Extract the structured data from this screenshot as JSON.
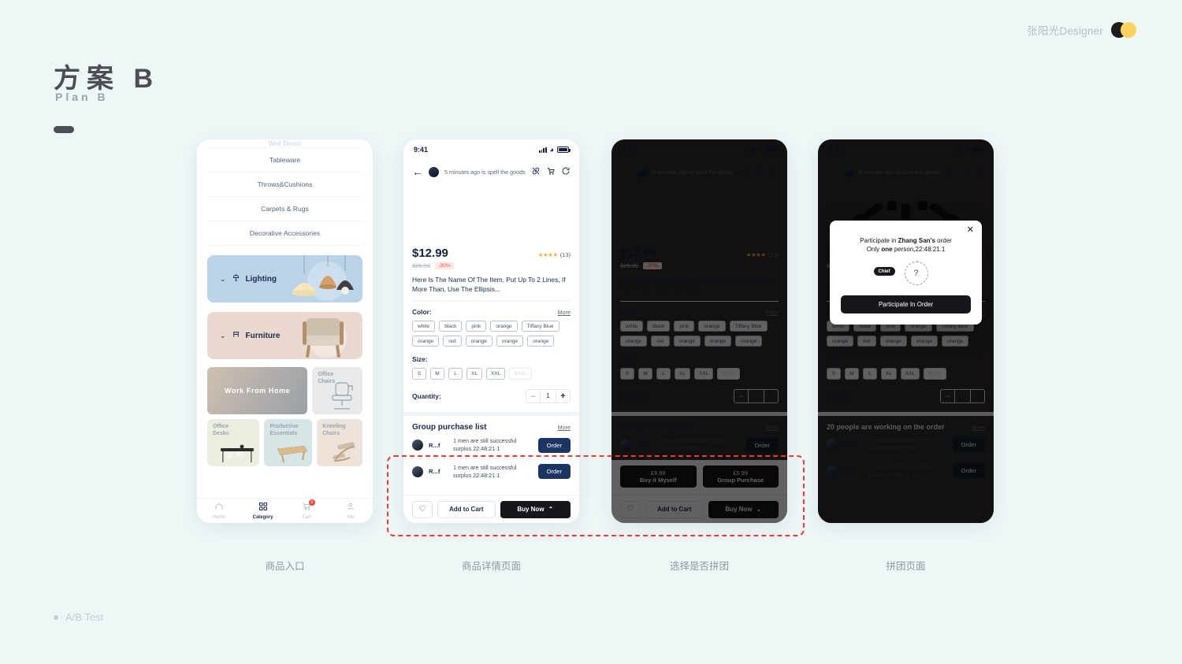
{
  "header": {
    "designer": "张阳光Designer",
    "title_cn": "方案 B",
    "title_en": "Plan B",
    "ab_test": "A/B Test"
  },
  "colors": {
    "background": "#eef6f6",
    "accent_navy": "#1c3461",
    "accent_dark": "#15171a",
    "annotation_red": "#ef3b35",
    "logo_yellow": "#fbd161",
    "lighting_banner": "#b9d3e8",
    "furniture_banner": "#ead9cf"
  },
  "statusbar": {
    "time": "9:41"
  },
  "phone1": {
    "categories": [
      "Wall Decor",
      "Tableware",
      "Throws&Cushions",
      "Carpets & Rugs",
      "Decorative Accessories"
    ],
    "banners": [
      {
        "label": "Lighting",
        "icon": "lamp-icon",
        "chevron": "⌄"
      },
      {
        "label": "Furniture",
        "icon": "stool-icon",
        "chevron": "⌄"
      }
    ],
    "tiles": [
      {
        "label": "Work From Home"
      },
      {
        "label": "Office\nChairs"
      },
      {
        "label": "Office\nDesks"
      },
      {
        "label": "Productive\nEssentials"
      },
      {
        "label": "Kneeling\nChairs"
      }
    ],
    "tabs": [
      {
        "label": "Home",
        "icon": "home-icon",
        "active": false,
        "badge": ""
      },
      {
        "label": "Category",
        "icon": "grid-icon",
        "active": true,
        "badge": ""
      },
      {
        "label": "Cart",
        "icon": "cart-icon",
        "active": false,
        "badge": "3"
      },
      {
        "label": "Me",
        "icon": "person-icon",
        "active": false,
        "badge": ""
      }
    ]
  },
  "detail": {
    "nav_text": "5 minutes ago is spell the goods",
    "nav_icons": [
      "link-off-icon",
      "cart-icon",
      "share-icon"
    ],
    "price": "$12.99",
    "old_price": "$25.99",
    "discount": "-30%",
    "stars": "★★★★",
    "rating_count": "(13)",
    "item_name": "Here Is The Name Of The Item, Put Up To 2 Lines, If More Than, Use The Ellipsis...",
    "color_label": "Color:",
    "more_label": "More",
    "colors": [
      "white",
      "black",
      "pink",
      "orange",
      "Tiffany Blue",
      "orange",
      "red",
      "orange",
      "orange",
      "orange"
    ],
    "size_label": "Size:",
    "sizes": [
      {
        "label": "S",
        "disabled": false
      },
      {
        "label": "M",
        "disabled": false
      },
      {
        "label": "L",
        "disabled": false
      },
      {
        "label": "XL",
        "disabled": false
      },
      {
        "label": "XXL",
        "disabled": false
      },
      {
        "label": "XXXL",
        "disabled": true
      }
    ],
    "quantity_label": "Quantity:",
    "quantity_value": "1",
    "quantity_minus": "–",
    "quantity_plus": "+",
    "group_title": "Group purchase list",
    "group_more": "More",
    "group_rows": [
      {
        "nick": "R...f",
        "desc": "1 men are still successful surplus 22:48:21·1",
        "action": "Order"
      },
      {
        "nick": "R...f",
        "desc": "1 men are still successful surplus 22:48:21·1",
        "action": "Order"
      }
    ],
    "bottom": {
      "favorite_icon": "heart-icon",
      "add_to_cart": "Add to Cart",
      "buy_now": "Buy Now",
      "chevron_up": "⌃",
      "chevron_down": "⌄"
    }
  },
  "phone3": {
    "buy_options": [
      {
        "price": "£9.99",
        "label": "Buy it Myself"
      },
      {
        "price": "£5.99",
        "label": "Group Purchase"
      }
    ]
  },
  "phone4": {
    "group_title": "20 people are working on the order",
    "group_more": "More",
    "modal": {
      "close_icon": "close-icon",
      "line1_pre": "Participate in ",
      "line1_name": "Zhang San's",
      "line1_post": " order",
      "line2_pre": "Only ",
      "line2_strong": "one",
      "line2_post": " person,22:48:21.1",
      "chief_tag": "Chief",
      "slot_placeholder": "?",
      "cta": "Participate In Order"
    }
  },
  "captions": [
    "商品入口",
    "商品详情页面",
    "选择是否拼团",
    "拼团页面"
  ]
}
